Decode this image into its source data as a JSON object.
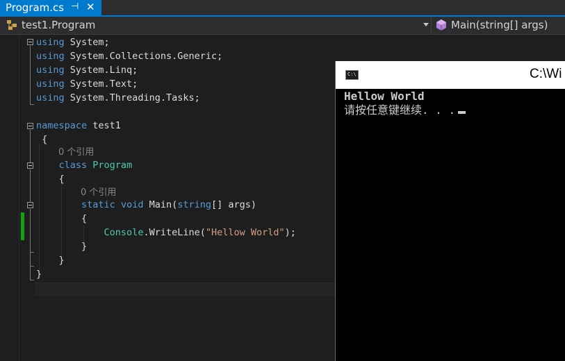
{
  "tab": {
    "title": "Program.cs",
    "pin_icon": "pin-icon",
    "close_icon": "close-icon"
  },
  "nav": {
    "left": "test1.Program",
    "right": "Main(string[] args)"
  },
  "code": {
    "using": "using",
    "system": "System;",
    "collections": "System.Collections.Generic;",
    "linq": "System.Linq;",
    "text": "System.Text;",
    "tasks": "System.Threading.Tasks;",
    "namespace_kw": "namespace",
    "namespace_name": "test1",
    "open_brace": "{",
    "close_brace": "}",
    "codelens": "0 个引用",
    "class_kw": "class",
    "class_name": "Program",
    "static_kw": "static",
    "void_kw": "void",
    "main_name": "Main(",
    "string_kw": "string",
    "main_rest": "[] args)",
    "console_type": "Console",
    "writeline": ".WriteLine(",
    "string_lit": "\"Hellow World\"",
    "stmt_end": ");"
  },
  "console_window": {
    "title": "C:\\Wi",
    "line1": "Hellow World",
    "line2": "请按任意键继续. . ."
  },
  "colors": {
    "accent": "#007acc",
    "keyword": "#569cd6",
    "type": "#4ec9b0",
    "string": "#d69d85",
    "change_bar": "#13a10e"
  }
}
